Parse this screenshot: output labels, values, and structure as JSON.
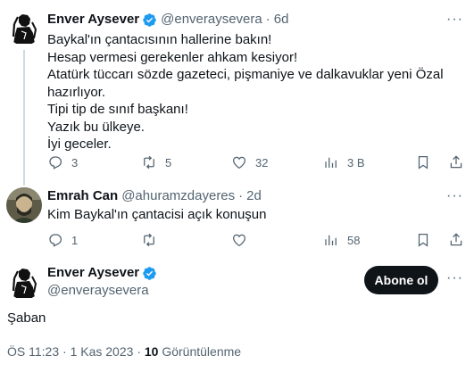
{
  "tweets": [
    {
      "name": "Enver Aysever",
      "handle": "@enveraysevera",
      "time": "6d",
      "lines": [
        "Baykal'ın çantacısının hallerine bakın!",
        "Hesap vermesi gerekenler ahkam kesiyor!",
        "Atatürk tüccarı sözde gazeteci, pişmaniye ve dalkavuklar yeni Özal",
        "hazırlıyor.",
        "Tipi tip de sınıf başkanı!",
        "Yazık bu ülkeye.",
        "İyi geceler."
      ],
      "replies": "3",
      "retweets": "5",
      "likes": "32",
      "views": "3 B"
    },
    {
      "name": "Emrah Can",
      "handle": "@ahuramzdayeres",
      "time": "2d",
      "lines": [
        "Kim Baykal'ın çantacisi açık konuşun"
      ],
      "replies": "1",
      "retweets": "",
      "likes": "",
      "views": "58"
    }
  ],
  "main_tweet": {
    "name": "Enver Aysever",
    "handle": "@enveraysevera",
    "follow_label": "Abone ol",
    "text": "Şaban",
    "time": "ÖS 11:23",
    "date": "1 Kas 2023",
    "views_count": "10",
    "views_label": "Görüntülenme"
  },
  "colors": {
    "verified": "#1d9bf0",
    "secondary_text": "#536471",
    "follow_button": "#0f1419"
  },
  "icons": [
    "verified-badge-icon",
    "more-icon",
    "reply-icon",
    "retweet-icon",
    "like-icon",
    "views-icon",
    "bookmark-icon",
    "share-icon"
  ]
}
